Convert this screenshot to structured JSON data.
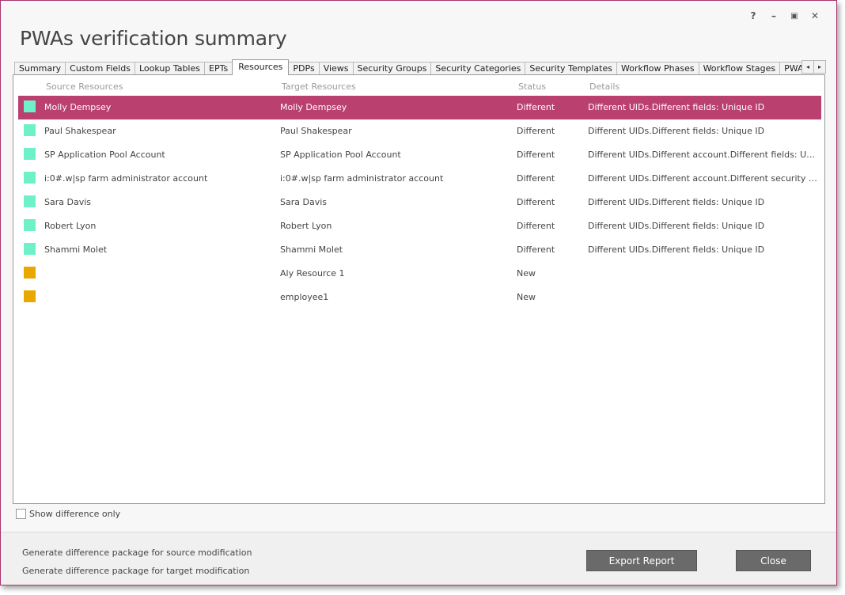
{
  "window": {
    "title": "PWAs verification summary",
    "controls": {
      "help": "?",
      "minimize": "–",
      "restore": "▣",
      "close": "✕"
    }
  },
  "tabs": [
    {
      "label": "Summary",
      "active": false
    },
    {
      "label": "Custom Fields",
      "active": false
    },
    {
      "label": "Lookup Tables",
      "active": false
    },
    {
      "label": "EPTs",
      "active": false
    },
    {
      "label": "Resources",
      "active": true
    },
    {
      "label": "PDPs",
      "active": false
    },
    {
      "label": "Views",
      "active": false
    },
    {
      "label": "Security Groups",
      "active": false
    },
    {
      "label": "Security Categories",
      "active": false
    },
    {
      "label": "Security Templates",
      "active": false
    },
    {
      "label": "Workflow Phases",
      "active": false
    },
    {
      "label": "Workflow Stages",
      "active": false
    },
    {
      "label": "PWA Per",
      "active": false
    }
  ],
  "tab_scroll": {
    "left": "◂",
    "right": "▸"
  },
  "table": {
    "columns": [
      "Source Resources",
      "Target Resources",
      "Status",
      "Details"
    ],
    "rows": [
      {
        "source": "Molly Dempsey",
        "target": "Molly Dempsey",
        "status": "Different",
        "details": "Different UIDs.Different fields: Unique ID",
        "swatch": "#6ef0c8",
        "selected": true
      },
      {
        "source": "Paul Shakespear",
        "target": "Paul Shakespear",
        "status": "Different",
        "details": "Different UIDs.Different fields: Unique ID",
        "swatch": "#6ef0c8",
        "selected": false
      },
      {
        "source": "SP Application Pool Account",
        "target": "SP Application Pool Account",
        "status": "Different",
        "details": "Different UIDs.Different account.Different fields: User ...",
        "swatch": "#6ef0c8",
        "selected": false
      },
      {
        "source": "i:0#.w|sp farm administrator account",
        "target": "i:0#.w|sp farm administrator account",
        "status": "Different",
        "details": "Different UIDs.Different account.Different security gro...",
        "swatch": "#6ef0c8",
        "selected": false
      },
      {
        "source": "Sara Davis",
        "target": "Sara Davis",
        "status": "Different",
        "details": "Different UIDs.Different fields: Unique ID",
        "swatch": "#6ef0c8",
        "selected": false
      },
      {
        "source": "Robert Lyon",
        "target": "Robert Lyon",
        "status": "Different",
        "details": "Different UIDs.Different fields: Unique ID",
        "swatch": "#6ef0c8",
        "selected": false
      },
      {
        "source": "Shammi Molet",
        "target": "Shammi Molet",
        "status": "Different",
        "details": "Different UIDs.Different fields: Unique ID",
        "swatch": "#6ef0c8",
        "selected": false
      },
      {
        "source": "",
        "target": "Aly Resource 1",
        "status": "New",
        "details": "",
        "swatch": "#e8a800",
        "selected": false
      },
      {
        "source": "",
        "target": "employee1",
        "status": "New",
        "details": "",
        "swatch": "#e8a800",
        "selected": false
      }
    ]
  },
  "options": {
    "show_difference_only": "Show difference only",
    "checked": false
  },
  "footer": {
    "link_source": "Generate difference package for source modification",
    "link_target": "Generate difference package for target modification",
    "export_button": "Export Report",
    "close_button": "Close"
  },
  "colors": {
    "accent": "#b9406f",
    "border": "#a8346e",
    "button": "#6a6a6a",
    "different": "#6ef0c8",
    "new": "#e8a800"
  }
}
